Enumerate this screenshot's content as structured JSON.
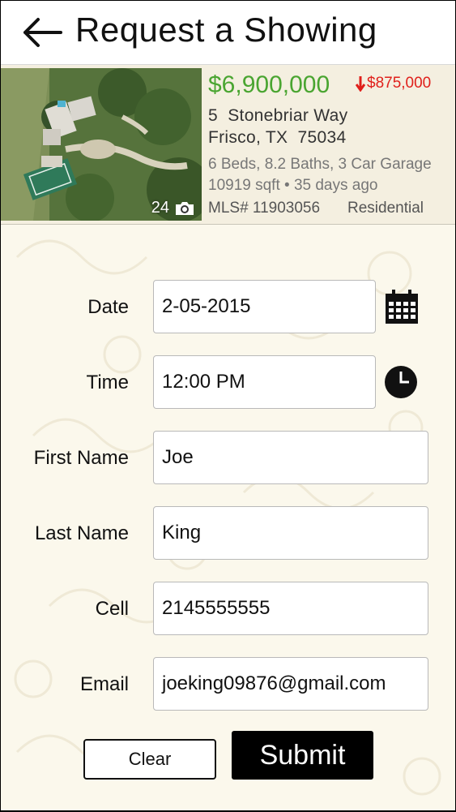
{
  "header": {
    "title": "Request a Showing",
    "back_icon": "back-arrow-icon"
  },
  "listing": {
    "price": "$6,900,000",
    "price_drop": "$875,000",
    "address_line1": "5  Stonebriar Way",
    "address_line2": "Frisco, TX  75034",
    "details": "6 Beds, 8.2 Baths, 3 Car Garage",
    "size_and_age": "10919 sqft • 35 days ago",
    "mls": "MLS# 11903056",
    "property_type": "Residential",
    "photo_count": "24",
    "colors": {
      "price": "#4aa531",
      "price_drop": "#e0201b"
    }
  },
  "form": {
    "date": {
      "label": "Date",
      "value": "2-05-2015"
    },
    "time": {
      "label": "Time",
      "value": "12:00 PM"
    },
    "first_name": {
      "label": "First Name",
      "value": "Joe"
    },
    "last_name": {
      "label": "Last Name",
      "value": "King"
    },
    "cell": {
      "label": "Cell",
      "value": "2145555555"
    },
    "email": {
      "label": "Email",
      "value": "joeking09876@gmail.com"
    }
  },
  "actions": {
    "clear": "Clear",
    "submit": "Submit"
  }
}
